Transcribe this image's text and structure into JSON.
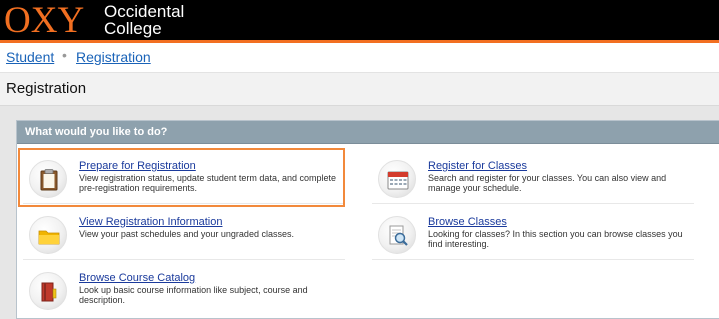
{
  "header": {
    "logo_mark": "OXY",
    "logo_line1": "Occidental",
    "logo_line2": "College",
    "brand_color": "#f26f21"
  },
  "breadcrumb": {
    "items": [
      "Student",
      "Registration"
    ],
    "separator": "•"
  },
  "page": {
    "title": "Registration"
  },
  "panel": {
    "heading": "What would you like to do?",
    "items": [
      {
        "title": "Prepare for Registration",
        "description": "View registration status, update student term data, and complete pre-registration requirements.",
        "icon": "clipboard-icon"
      },
      {
        "title": "Register for Classes",
        "description": "Search and register for your classes. You can also view and manage your schedule.",
        "icon": "calendar-icon"
      },
      {
        "title": "View Registration Information",
        "description": "View your past schedules and your ungraded classes.",
        "icon": "folder-icon"
      },
      {
        "title": "Browse Classes",
        "description": "Looking for classes? In this section you can browse classes you find interesting.",
        "icon": "magnifier-document-icon"
      },
      {
        "title": "Browse Course Catalog",
        "description": "Look up basic course information like subject, course and description.",
        "icon": "catalog-book-icon"
      }
    ]
  },
  "colors": {
    "link": "#1a3a9c",
    "panel_header": "#8ea1ad",
    "highlight": "#f2893b"
  }
}
